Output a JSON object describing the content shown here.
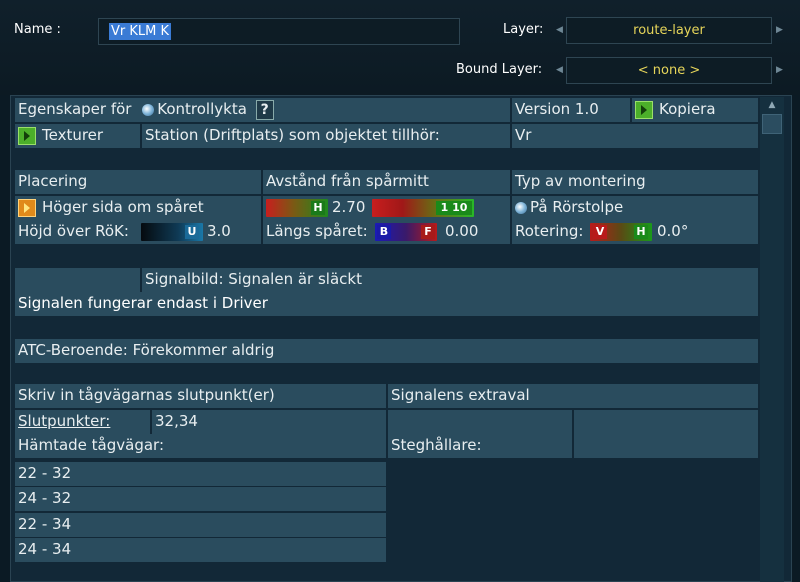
{
  "header": {
    "name_label": "Name :",
    "name_value": "Vr KLM K",
    "layer_label": "Layer:",
    "layer_value": "route-layer",
    "bound_layer_label": "Bound Layer:",
    "bound_layer_value": "< none >"
  },
  "props": {
    "egenskaper_label": "Egenskaper för",
    "kontrollykta": "Kontrollykta",
    "help": "?",
    "version": "Version 1.0",
    "kopiera": "Kopiera",
    "texturer": "Texturer",
    "station_label": "Station (Driftplats) som objektet tillhör:",
    "station_value": "Vr"
  },
  "placement": {
    "placering": "Placering",
    "avstand": "Avstånd från spårmitt",
    "typ": "Typ av montering",
    "hoger": "Höger sida om spåret",
    "avstand_slider_label": "H",
    "avstand_value": "2.70",
    "avstand2_value": "1 10",
    "montering_value": "På Rörstolpe",
    "hojd_label": "Höjd över RöK:",
    "hojd_slider_label": "U",
    "hojd_value": "3.0",
    "langs_label": "Längs spåret:",
    "langs_b": "B",
    "langs_f": "F",
    "langs_value": "0.00",
    "rotering_label": "Rotering:",
    "rot_v": "V",
    "rot_h": "H",
    "rot_value": "0.0°"
  },
  "signal": {
    "signalbild": "Signalbild: Signalen är släckt",
    "driver_note": "Signalen fungerar endast i Driver",
    "atc": "ATC-Beroende:  Förekommer aldrig"
  },
  "routes": {
    "skriv": "Skriv in tågvägarnas slutpunkt(er)",
    "extraval": "Signalens extraval",
    "slutpunkter_label": "Slutpunkter:",
    "slutpunkter_value": "32,34",
    "hamtade": "Hämtade tågvägar:",
    "steghallare": "Steghållare:",
    "list": [
      "22 - 32",
      "24 - 32",
      "22 - 34",
      "24 - 34"
    ]
  },
  "colors": {
    "accent_yellow": "#e6d55a",
    "cell_bg": "#2a4c5e",
    "panel_bg": "#122837"
  }
}
